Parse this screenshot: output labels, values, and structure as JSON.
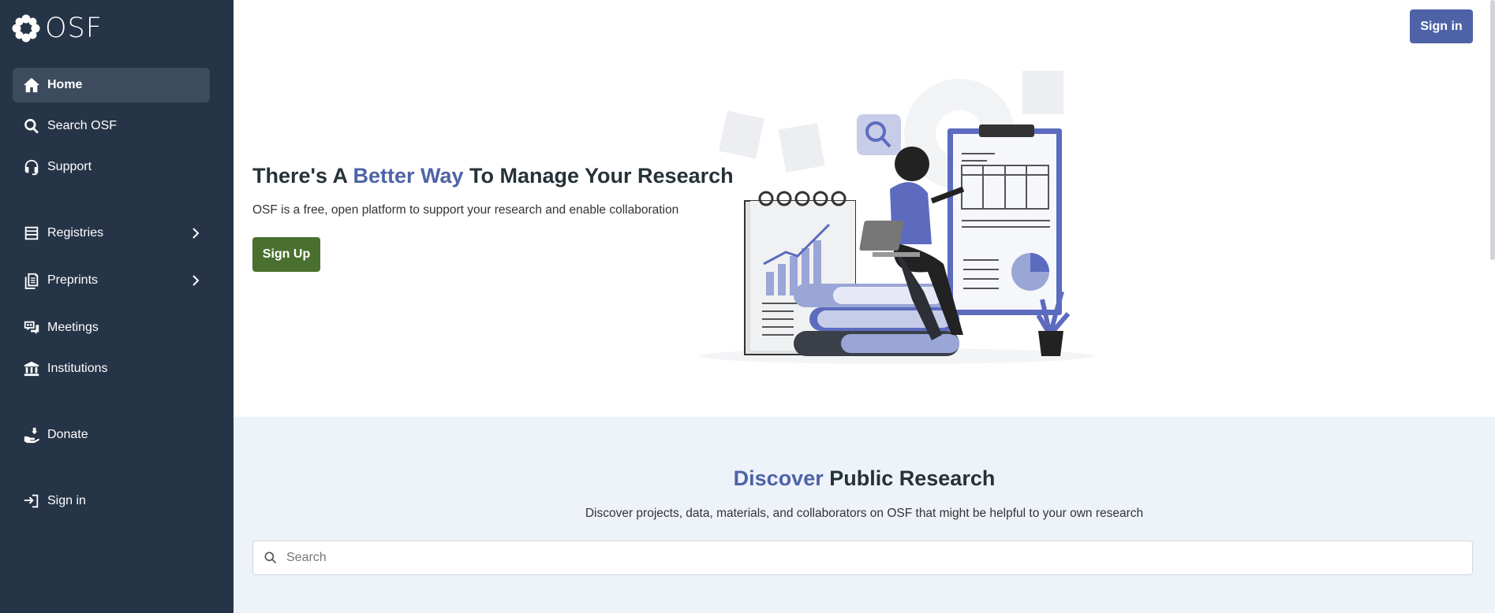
{
  "app": {
    "name": "OSF"
  },
  "sidebar": {
    "items": [
      {
        "label": "Home",
        "icon": "home-icon",
        "active": true
      },
      {
        "label": "Search OSF",
        "icon": "search-icon"
      },
      {
        "label": "Support",
        "icon": "headset-icon"
      },
      {
        "label": "Registries",
        "icon": "registries-icon",
        "expandable": true
      },
      {
        "label": "Preprints",
        "icon": "preprints-icon",
        "expandable": true
      },
      {
        "label": "Meetings",
        "icon": "meetings-icon"
      },
      {
        "label": "Institutions",
        "icon": "institution-icon"
      },
      {
        "label": "Donate",
        "icon": "donate-icon"
      },
      {
        "label": "Sign in",
        "icon": "sign-in-icon"
      }
    ]
  },
  "header": {
    "signin_label": "Sign in"
  },
  "hero": {
    "title_prefix": "There's A ",
    "title_accent": "Better Way",
    "title_suffix": " To Manage Your Research",
    "subtitle": "OSF is a free, open platform to support your research and enable collaboration",
    "signup_label": "Sign Up"
  },
  "discover": {
    "title_accent": "Discover",
    "title_rest": " Public Research",
    "subtitle": "Discover projects, data, materials, and collaborators on OSF that might be helpful to your own research",
    "search_placeholder": "Search"
  },
  "colors": {
    "sidebar_bg": "#263447",
    "accent": "#4e63a7",
    "signup_green": "#4a7030",
    "discover_bg": "#eef3fa"
  }
}
